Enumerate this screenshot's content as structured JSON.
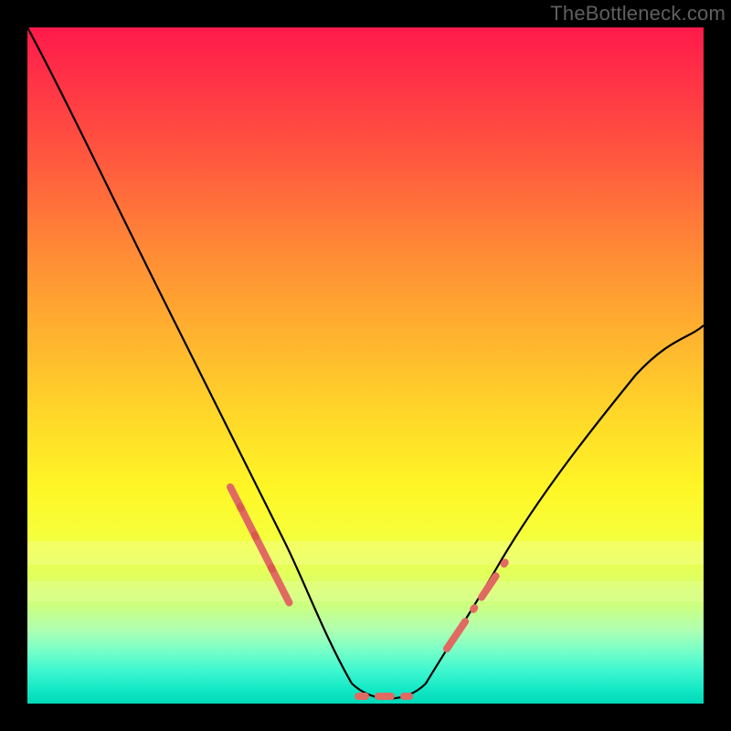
{
  "watermark": "TheBottleneck.com",
  "chart_data": {
    "type": "line",
    "title": "",
    "xlabel": "",
    "ylabel": "",
    "xlim": [
      0,
      100
    ],
    "ylim": [
      0,
      100
    ],
    "grid": false,
    "series": [
      {
        "name": "curve",
        "x": [
          0,
          5,
          12,
          20,
          28,
          34,
          38,
          41,
          43,
          46,
          48,
          50,
          53,
          57,
          59,
          62,
          66,
          70,
          76,
          83,
          90,
          96,
          100
        ],
        "y": [
          100,
          90,
          76,
          60,
          44,
          32,
          24,
          17,
          12,
          7,
          3,
          1,
          0,
          0,
          1,
          3,
          8,
          14,
          23,
          33,
          43,
          51,
          56
        ]
      },
      {
        "name": "marker-band-left",
        "x": [
          30,
          32,
          34,
          36,
          38,
          40,
          42,
          44
        ],
        "y": [
          24,
          21.5,
          19,
          16.5,
          14,
          11.5,
          9,
          6.5
        ]
      },
      {
        "name": "marker-band-bottom",
        "x": [
          49,
          51,
          53,
          55,
          57,
          59
        ],
        "y": [
          1,
          0.5,
          0,
          0,
          0.3,
          1
        ]
      },
      {
        "name": "marker-band-right",
        "x": [
          60,
          62,
          64,
          66,
          68,
          70,
          72,
          74
        ],
        "y": [
          3,
          5,
          8,
          11,
          14,
          17,
          20,
          22
        ]
      }
    ],
    "bands": [
      {
        "y_from": 21,
        "y_to": 24,
        "alpha": 0.18
      },
      {
        "y_from": 15,
        "y_to": 18,
        "alpha": 0.14
      }
    ],
    "colors": {
      "curve": "#000000",
      "markers": "#e06a62",
      "gradient_top": "#ff1a4b",
      "gradient_bottom": "#00d8b8"
    }
  }
}
